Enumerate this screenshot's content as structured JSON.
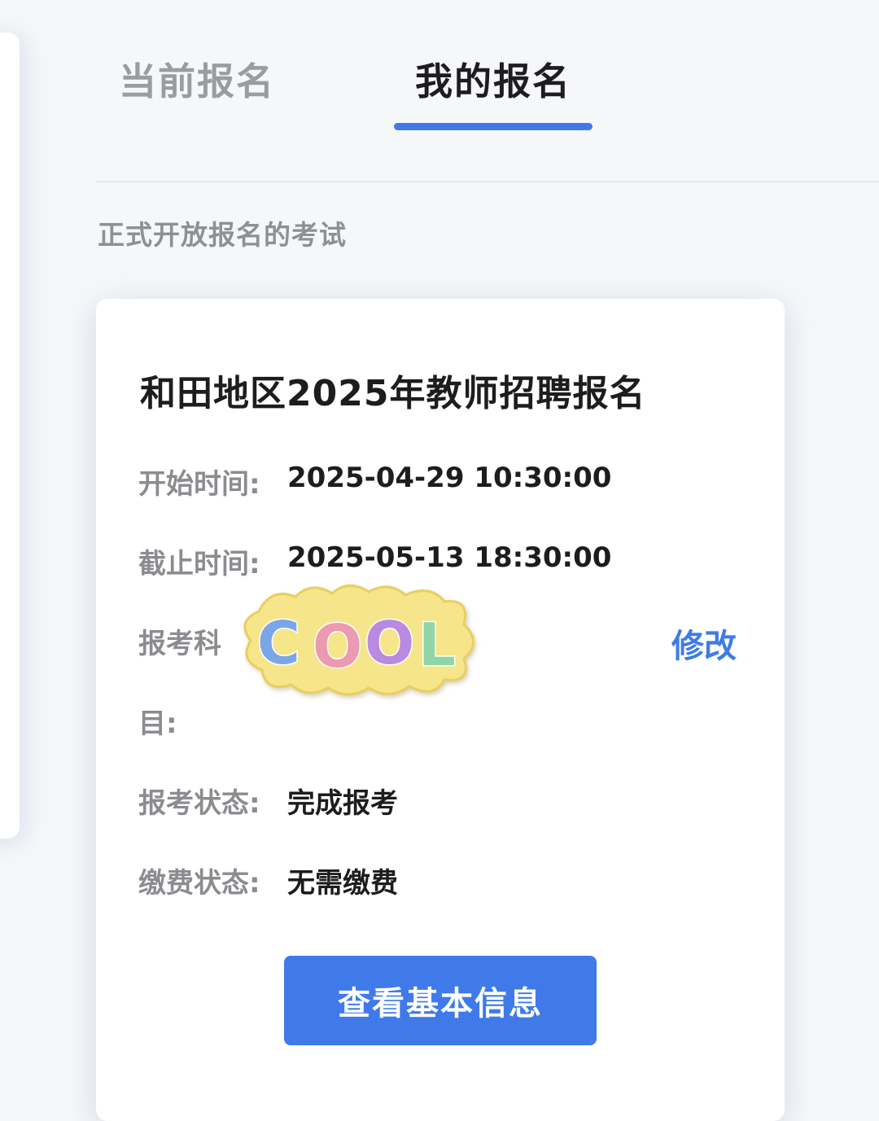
{
  "tabs": {
    "current": "当前报名",
    "mine": "我的报名"
  },
  "section_title": "正式开放报名的考试",
  "card": {
    "title": "和田地区2025年教师招聘报名",
    "start_label": "开始时间:",
    "start_value": "2025-04-29  10:30:00",
    "end_label": "截止时间:",
    "end_value": "2025-05-13  18:30:00",
    "subject_label_line1": "报考科",
    "subject_label_line2": "目:",
    "edit_label": "修改",
    "status_label": "报考状态:",
    "status_value": "完成报考",
    "fee_label": "缴费状态:",
    "fee_value": "无需缴费",
    "view_button": "查看基本信息"
  },
  "sticker": {
    "text": "COOL"
  },
  "colors": {
    "accent": "#3f7ae8",
    "background": "#f6f7f9",
    "card": "#ffffff",
    "label_gray": "#8a8c90",
    "text_dark": "#1d1d1f"
  }
}
